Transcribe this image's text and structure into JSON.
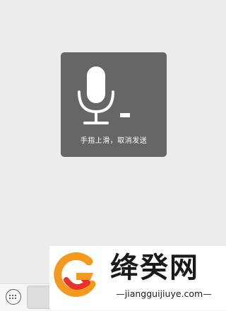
{
  "voice_overlay": {
    "hint": "手指上滑，取消发送"
  },
  "icons": {
    "microphone": "microphone-icon",
    "keyboard": "keyboard-icon"
  },
  "input_bar": {
    "hold_to_talk_label": ""
  },
  "watermark": {
    "name": "绛癸网",
    "url": "—jiangguijiuye.com—"
  },
  "colors": {
    "background": "#ececec",
    "overlay": "#5a5a5a",
    "overlay_text": "#ffffff",
    "logo_orange": "#f39a1e",
    "logo_red": "#e8322b"
  }
}
